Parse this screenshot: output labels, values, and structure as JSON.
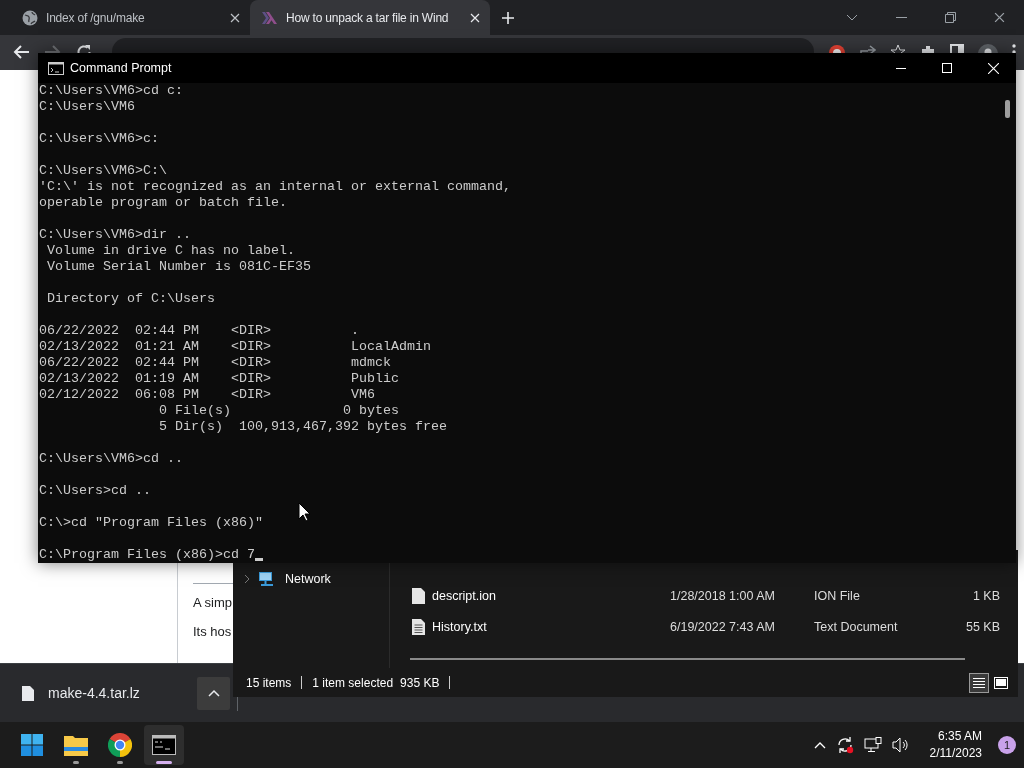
{
  "browser": {
    "tabs": [
      {
        "title": "Index of /gnu/make",
        "kind": "globe",
        "selected": false
      },
      {
        "title": "How to unpack a tar file in Wind",
        "kind": "haskell",
        "selected": true
      }
    ],
    "nav": [
      {
        "kind": "back",
        "disabled": false
      },
      {
        "kind": "forward",
        "disabled": true
      },
      {
        "kind": "reload",
        "disabled": false
      }
    ],
    "page": {
      "paragraphs": [
        "A simp",
        "Its hos"
      ]
    },
    "download": {
      "file": "make-4.4.tar.lz"
    }
  },
  "command_prompt": {
    "title": "Command Prompt",
    "blocks": [
      [
        "C:\\Users\\VM6>cd c:",
        "C:\\Users\\VM6"
      ],
      [
        "C:\\Users\\VM6>c:"
      ],
      [
        "C:\\Users\\VM6>C:\\",
        "'C:\\' is not recognized as an internal or external command,",
        "operable program or batch file."
      ],
      [
        "C:\\Users\\VM6>dir ..",
        " Volume in drive C has no label.",
        " Volume Serial Number is 081C-EF35"
      ],
      [
        " Directory of C:\\Users"
      ],
      [
        "06/22/2022  02:44 PM    <DIR>          .",
        "02/13/2022  01:21 AM    <DIR>          LocalAdmin",
        "06/22/2022  02:44 PM    <DIR>          mdmck",
        "02/13/2022  01:19 AM    <DIR>          Public",
        "02/12/2022  06:08 PM    <DIR>          VM6",
        "               0 File(s)              0 bytes",
        "               5 Dir(s)  100,913,467,392 bytes free"
      ],
      [
        "C:\\Users\\VM6>cd .."
      ],
      [
        "C:\\Users>cd .."
      ],
      [
        "C:\\>cd \"Program Files (x86)\""
      ],
      [
        "C:\\Program Files (x86)>cd 7"
      ]
    ]
  },
  "explorer": {
    "nav": [
      {
        "label": "Network",
        "expanded": false
      }
    ],
    "files": [
      {
        "kind": "file",
        "name": "descript.ion",
        "date": "1/28/2018 1:00 AM",
        "type": "ION File",
        "size": "1 KB"
      },
      {
        "kind": "text",
        "name": "History.txt",
        "date": "6/19/2022 7:43 AM",
        "type": "Text Document",
        "size": "55 KB"
      }
    ],
    "status": {
      "count": "15 items",
      "selection": "1 item selected",
      "size": "935 KB"
    },
    "views": [
      {
        "kind": "details",
        "selected": true
      },
      {
        "kind": "tiles",
        "selected": false
      }
    ]
  },
  "taskbar": {
    "apps": [
      {
        "kind": "start",
        "active": false,
        "running": false
      },
      {
        "kind": "explorer",
        "active": false,
        "running": true
      },
      {
        "kind": "chrome",
        "active": false,
        "running": true
      },
      {
        "kind": "terminal",
        "active": true,
        "running": true
      }
    ],
    "time": "6:35 AM",
    "date": "2/11/2023",
    "notifications": "1"
  }
}
